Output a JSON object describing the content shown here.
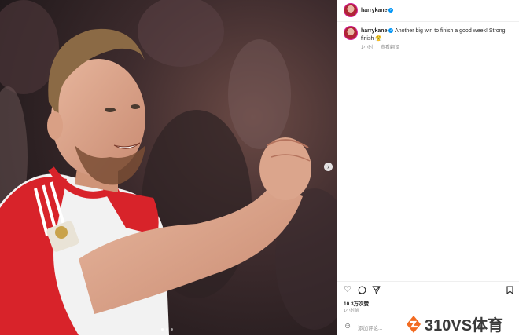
{
  "post": {
    "username": "harrykane",
    "verified_mark": "✓",
    "caption": "Another big win to finish a good week! Strong finish",
    "caption_emoji": "😤",
    "time_ago": "1小时",
    "translate_label": "查看翻译",
    "likes": "10.3万次赞",
    "posted_ago": "1小时前",
    "comment_placeholder": "添加评论..."
  },
  "icons": {
    "like": "heart-icon",
    "comment": "comment-icon",
    "share": "share-icon",
    "save": "bookmark-icon",
    "emoji": "emoji-icon",
    "next": "chevron-right-icon"
  },
  "carousel": {
    "slides": 3,
    "active_index": 0
  },
  "watermark": {
    "text": "310VS体育"
  },
  "colors": {
    "verified_blue": "#0095f6",
    "jersey_red": "#d8232a",
    "watermark_orange": "#f26b21"
  }
}
